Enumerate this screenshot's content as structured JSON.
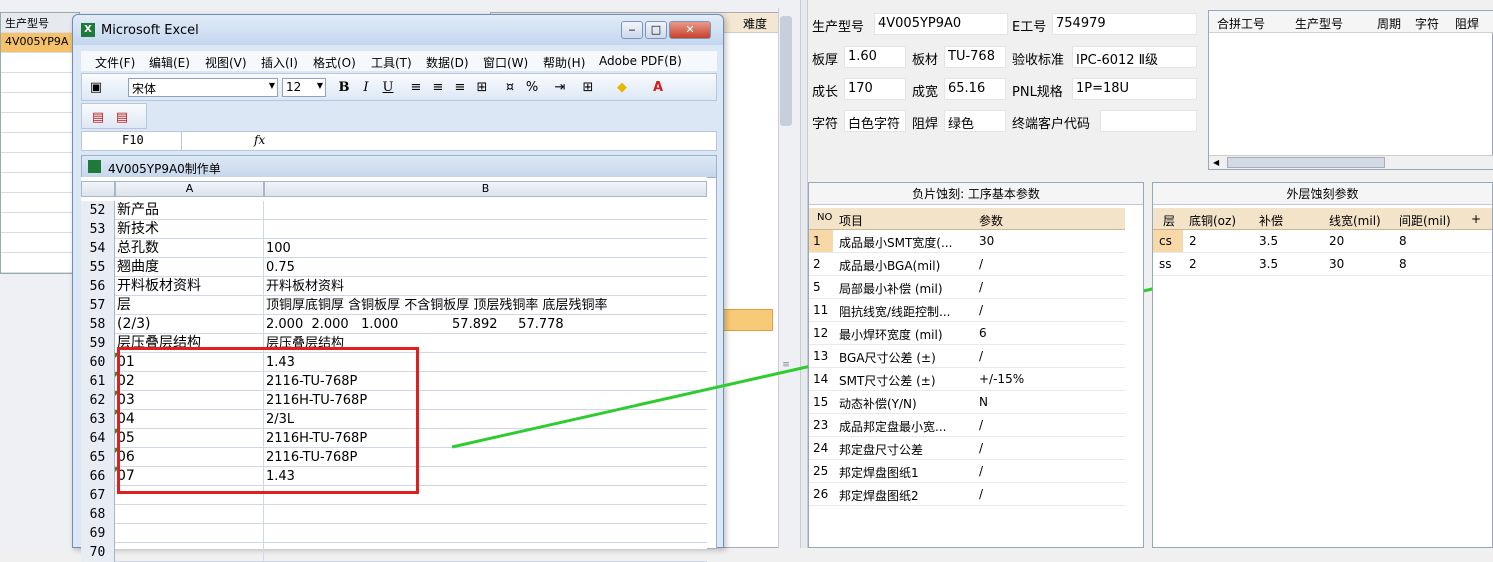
{
  "bg": {
    "col1_header": "生产型号",
    "col1_row1": "4V005YP9A",
    "right_header_last": "难度"
  },
  "excel": {
    "title": "Microsoft Excel",
    "menu": [
      "文件(F)",
      "编辑(E)",
      "视图(V)",
      "插入(I)",
      "格式(O)",
      "工具(T)",
      "数据(D)",
      "窗口(W)",
      "帮助(H)",
      "Adobe PDF(B)"
    ],
    "font_name": "宋体",
    "font_size": "12",
    "name_box": "F10",
    "workbook_title": "4V005YP9A0制作单",
    "col_a": "A",
    "col_b": "B",
    "rows": [
      {
        "n": "52",
        "a": "新产品",
        "b": ""
      },
      {
        "n": "53",
        "a": "新技术",
        "b": ""
      },
      {
        "n": "54",
        "a": "总孔数",
        "b": "100"
      },
      {
        "n": "55",
        "a": "翘曲度",
        "b": "0.75"
      },
      {
        "n": "56",
        "a": "开料板材资料",
        "b": "开料板材资料"
      },
      {
        "n": "57",
        "a": "层",
        "b": "顶铜厚底铜厚 含铜板厚 不含铜板厚 顶层残铜率 底层残铜率"
      },
      {
        "n": "58",
        "a": "(2/3)",
        "b": "2.000  2.000   1.000             57.892     57.778"
      },
      {
        "n": "59",
        "a": "层压叠层结构",
        "b": "层压叠层结构"
      },
      {
        "n": "60",
        "a": "01",
        "b": "1.43"
      },
      {
        "n": "61",
        "a": "02",
        "b": "2116-TU-768P"
      },
      {
        "n": "62",
        "a": "03",
        "b": "2116H-TU-768P"
      },
      {
        "n": "63",
        "a": "04",
        "b": "2/3L"
      },
      {
        "n": "64",
        "a": "05",
        "b": "2116H-TU-768P"
      },
      {
        "n": "65",
        "a": "06",
        "b": "2116-TU-768P"
      },
      {
        "n": "66",
        "a": "07",
        "b": "1.43"
      },
      {
        "n": "67",
        "a": "",
        "b": ""
      },
      {
        "n": "68",
        "a": "",
        "b": ""
      },
      {
        "n": "69",
        "a": "",
        "b": ""
      },
      {
        "n": "70",
        "a": "",
        "b": ""
      }
    ]
  },
  "info": {
    "model_label": "生产型号",
    "model_value": "4V005YP9A0",
    "eno_label": "E工号",
    "eno_value": "754979",
    "thick_label": "板厚",
    "thick_value": "1.60",
    "material_label": "板材",
    "material_value": "TU-768",
    "std_label": "验收标准",
    "std_value": "IPC-6012 Ⅱ级",
    "len_label": "成长",
    "len_value": "170",
    "wid_label": "成宽",
    "wid_value": "65.16",
    "pnl_label": "PNL规格",
    "pnl_value": "1P=18U",
    "char_label": "字符",
    "char_value": "白色字符",
    "mask_label": "阻焊",
    "mask_value": "绿色",
    "cust_label": "终端客户代码",
    "cust_value": ""
  },
  "combine": {
    "headers": [
      "合拼工号",
      "生产型号",
      "周期",
      "字符",
      "阻焊"
    ]
  },
  "neg": {
    "title": "负片蚀刻: 工序基本参数",
    "headers": [
      "NO",
      "项目",
      "参数"
    ],
    "rows": [
      {
        "no": "1",
        "item": "成品最小SMT宽度(...",
        "val": "30"
      },
      {
        "no": "2",
        "item": "成品最小BGA(mil)",
        "val": "/"
      },
      {
        "no": "5",
        "item": "局部最小补偿 (mil)",
        "val": "/"
      },
      {
        "no": "11",
        "item": "阻抗线宽/线距控制...",
        "val": "/"
      },
      {
        "no": "12",
        "item": "最小焊环宽度 (mil)",
        "val": "6"
      },
      {
        "no": "13",
        "item": "BGA尺寸公差 (±)",
        "val": "/"
      },
      {
        "no": "14",
        "item": "SMT尺寸公差 (±)",
        "val": "+/-15%"
      },
      {
        "no": "15",
        "item": "动态补偿(Y/N)",
        "val": "N"
      },
      {
        "no": "23",
        "item": "成品邦定盘最小宽...",
        "val": "/"
      },
      {
        "no": "24",
        "item": "邦定盘尺寸公差",
        "val": "/"
      },
      {
        "no": "25",
        "item": "邦定焊盘图纸1",
        "val": "/"
      },
      {
        "no": "26",
        "item": "邦定焊盘图纸2",
        "val": "/"
      }
    ]
  },
  "outer": {
    "title": "外层蚀刻参数",
    "headers": [
      "层",
      "底铜(oz)",
      "补偿",
      "线宽(mil)",
      "间距(mil)",
      "+"
    ],
    "rows": [
      {
        "layer": "cs",
        "cu": "2",
        "comp": "3.5",
        "lw": "20",
        "sp": "8"
      },
      {
        "layer": "ss",
        "cu": "2",
        "comp": "3.5",
        "lw": "30",
        "sp": "8"
      }
    ]
  },
  "colors": {
    "highlight": "#f6d9a6",
    "arrow": "#2ecc2e",
    "redbox": "#e02020"
  }
}
